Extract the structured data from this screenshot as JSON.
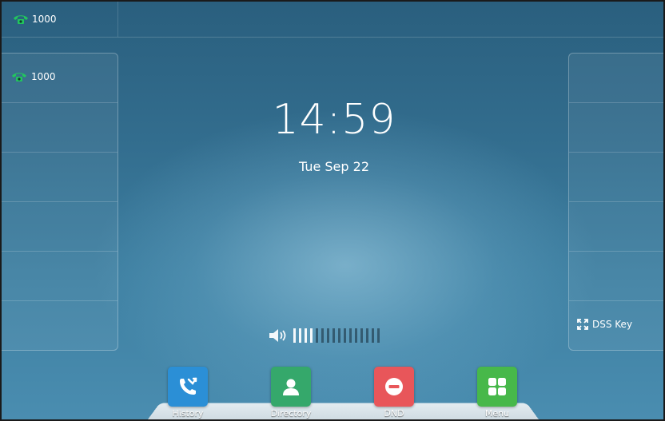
{
  "topbar": {
    "account_label": "1000"
  },
  "left_panel": {
    "line_keys": [
      {
        "label": "1000",
        "icon": "green-phone-icon"
      },
      {
        "label": ""
      },
      {
        "label": ""
      },
      {
        "label": ""
      },
      {
        "label": ""
      },
      {
        "label": ""
      }
    ]
  },
  "right_panel": {
    "dss_key_label": "DSS Key",
    "dss_key_icon": "expand-arrows-icon"
  },
  "clock": {
    "time": "14:59",
    "date": "Tue Sep 22"
  },
  "volume": {
    "icon": "speaker-icon",
    "level": 4,
    "max": 16
  },
  "softkeys": {
    "history": {
      "label": "History",
      "icon": "missed-call-icon",
      "color": "#2b8fd6"
    },
    "directory": {
      "label": "Directory",
      "icon": "contact-person-icon",
      "color": "#35a86b"
    },
    "dnd": {
      "label": "DND",
      "icon": "minus-circle-icon",
      "color": "#e8565a"
    },
    "menu": {
      "label": "Menu",
      "icon": "grid-icon",
      "color": "#47b84a"
    }
  },
  "colors": {
    "accent_green": "#22c55e",
    "background": "#336e8f"
  }
}
